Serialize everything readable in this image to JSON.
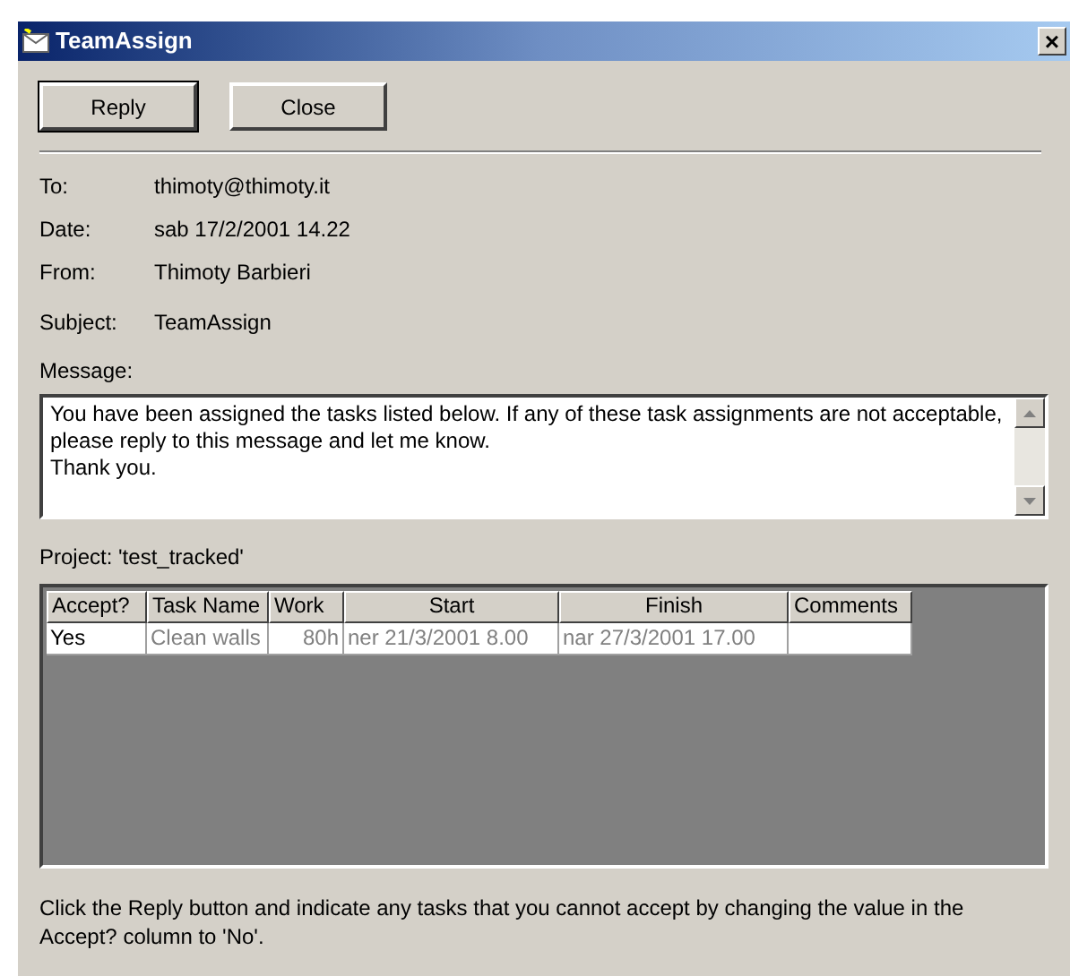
{
  "window": {
    "title": "TeamAssign",
    "close": "×"
  },
  "buttons": [
    {
      "label": "Reply",
      "selected": true
    },
    {
      "label": "Close",
      "selected": false
    }
  ],
  "fields": [
    {
      "label": "To:",
      "value": "thimoty@thimoty.it"
    },
    {
      "label": "Date:",
      "value": "sab 17/2/2001 14.22"
    },
    {
      "label": "From:",
      "value": "Thimoty Barbieri"
    },
    {
      "label": "Subject:",
      "value": "TeamAssign"
    }
  ],
  "message": {
    "label": "Message:",
    "lines": [
      "You have been assigned the tasks listed below. If any of these task assignments are not acceptable, please reply to this message and let me know.",
      "Thank you."
    ]
  },
  "project": "Project: 'test_tracked'",
  "table": {
    "columns": [
      "Accept?",
      "Task Name",
      "Work",
      "Start",
      "Finish",
      "Comments"
    ],
    "rows": [
      {
        "cells": [
          {
            "text": "Yes",
            "disabled": false
          },
          {
            "text": "Clean walls",
            "disabled": true
          },
          {
            "text": "80h",
            "disabled": true
          },
          {
            "text": "ner 21/3/2001 8.00",
            "disabled": true
          },
          {
            "text": "nar 27/3/2001 17.00",
            "disabled": true
          }
        ]
      }
    ]
  },
  "footer": "Click the Reply button and indicate any tasks that you cannot accept by changing the value in the Accept? column to 'No'."
}
